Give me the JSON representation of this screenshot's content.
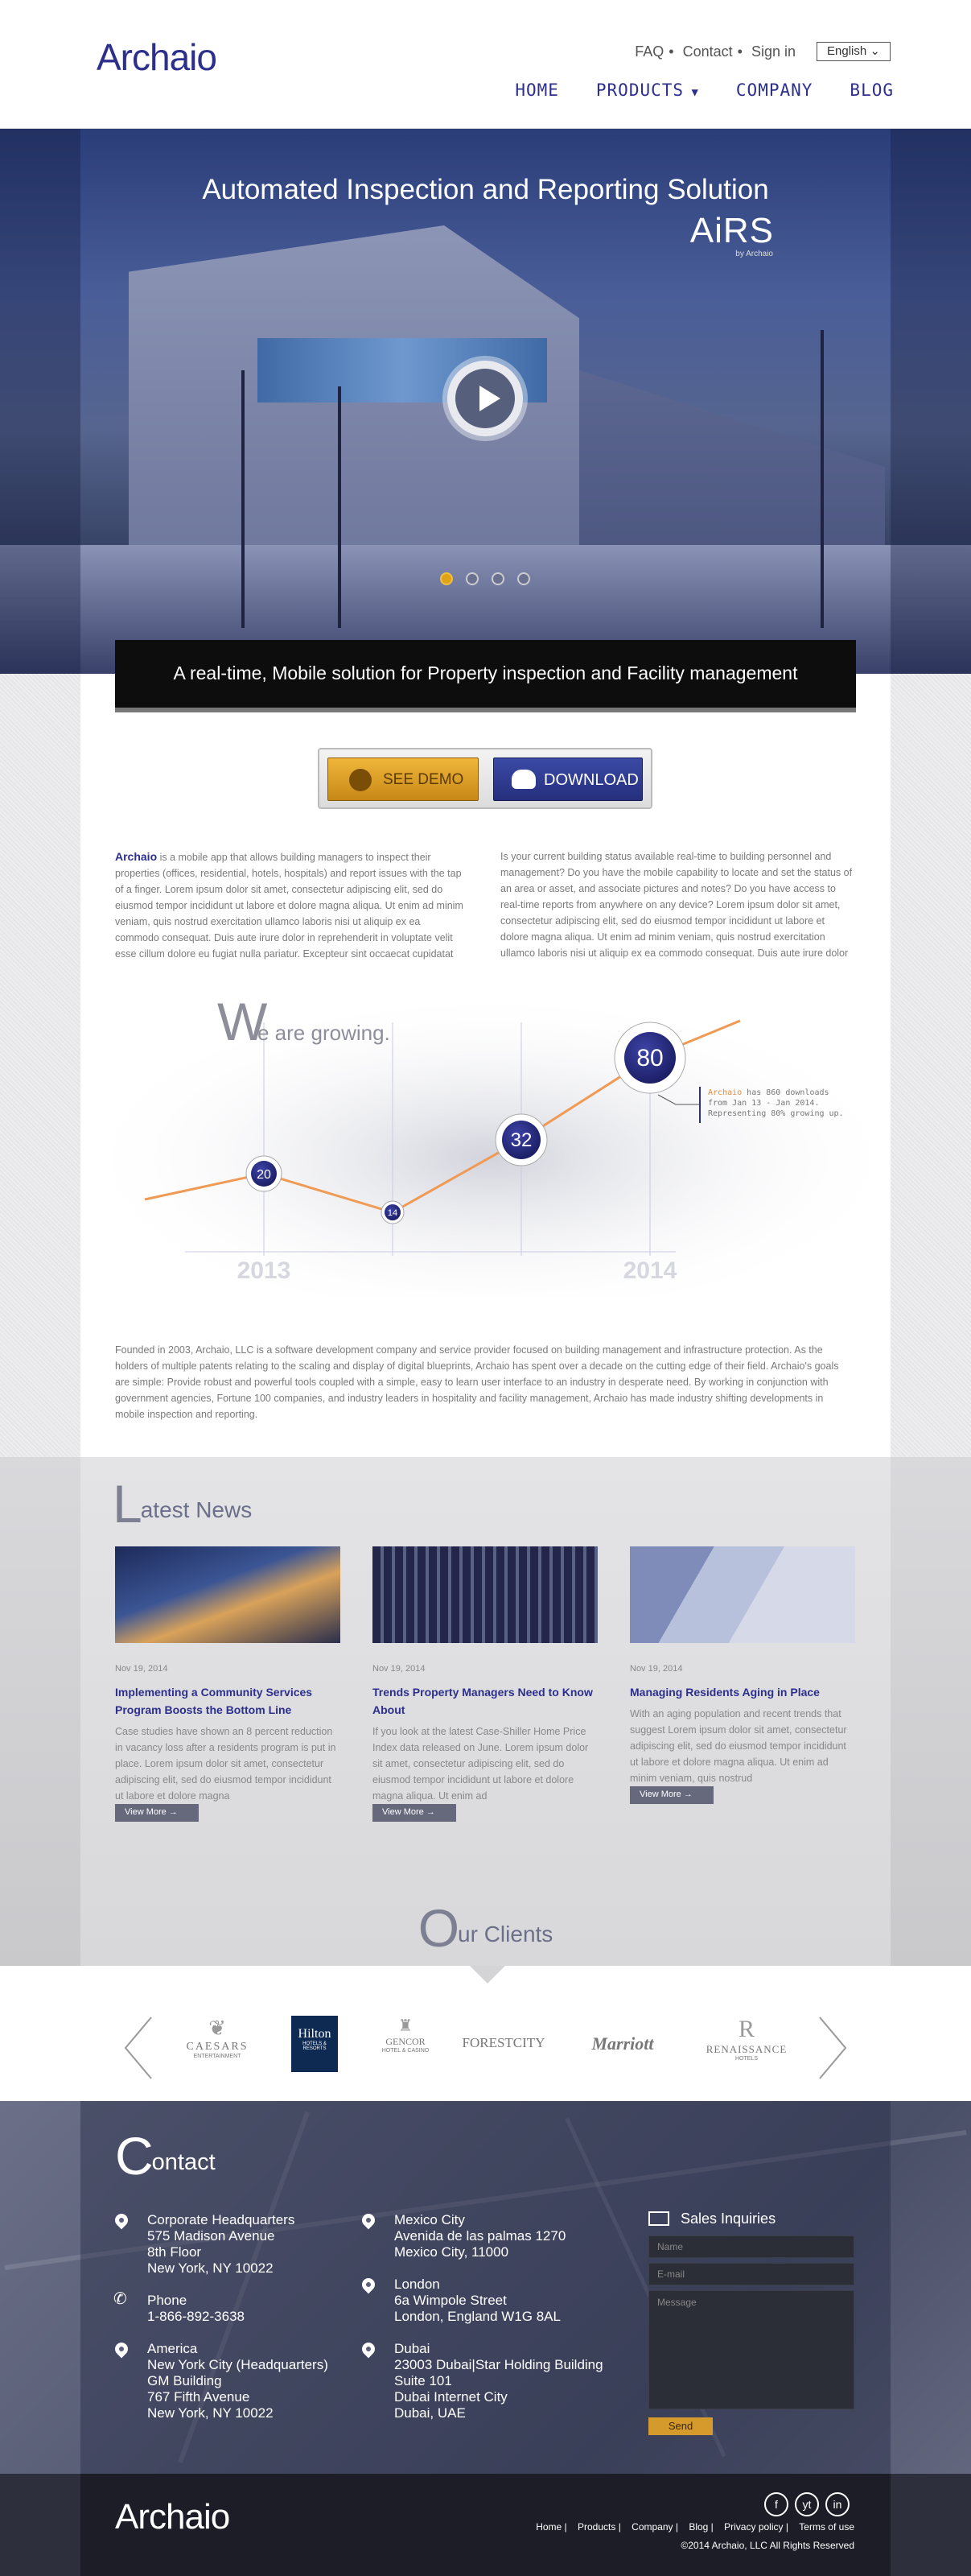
{
  "header": {
    "logo": "Archaio",
    "top_links": [
      "FAQ",
      "Contact",
      "Sign in"
    ],
    "language": "English",
    "nav": [
      "HOME",
      "PRODUCTS",
      "COMPANY",
      "BLOG"
    ]
  },
  "hero": {
    "title": "Automated Inspection and Reporting Solution",
    "product": "AiRS",
    "product_sub": "by Archaio",
    "slides": 4,
    "active_slide": 1,
    "tagline": "A real-time, Mobile solution for Property inspection and Facility management"
  },
  "buttons": {
    "demo": "SEE DEMO",
    "download": "DOWNLOAD"
  },
  "intro": {
    "left_brand": "Archaio",
    "left": " is a mobile app that allows building managers to inspect their properties (offices, residential, hotels, hospitals) and report issues with the tap of a finger. Lorem ipsum dolor sit amet, consectetur adipiscing elit, sed do eiusmod tempor incididunt ut labore et dolore magna aliqua. Ut enim ad minim veniam, quis nostrud exercitation ullamco laboris nisi ut aliquip ex ea commodo consequat. Duis aute irure dolor in reprehenderit in voluptate velit esse cillum dolore eu fugiat nulla pariatur. Excepteur sint occaecat cupidatat non proident, sunt in",
    "right": "Is your current building status available real-time to building personnel and management? Do you have the mobile capability to locate and set the status of an area or asset, and associate pictures and notes? Do you have access to real-time reports from anywhere on any device? Lorem ipsum dolor sit amet, consectetur adipiscing elit, sed do eiusmod tempor incididunt ut labore et dolore magna aliqua. Ut enim ad minim veniam, quis nostrud exercitation ullamco laboris nisi ut aliquip ex ea commodo consequat. Duis aute irure dolor in"
  },
  "growth": {
    "heading_initial": "W",
    "heading_rest": "e are growing.",
    "points": [
      "20",
      "14",
      "32",
      "80"
    ],
    "years": [
      "2013",
      "2014"
    ],
    "note_brand": "Archaio",
    "note_line1": " has 860 downloads",
    "note_line2": "from Jan 13 - Jan 2014.",
    "note_line3": "Representing 80% growing up."
  },
  "founded": "Founded in 2003, Archaio, LLC is a software development company and service provider focused on building management and infrastructure protection. As the holders of multiple patents relating to the scaling and display of digital blueprints, Archaio has spent over a decade on the cutting edge of their field. Archaio's goals are simple: Provide robust and powerful tools coupled with a simple, easy to learn user interface to an industry in desperate need. By working in conjunction with government agencies, Fortune 100 companies, and industry leaders in hospitality and facility management, Archaio has made industry shifting developments in mobile inspection and reporting.",
  "news": {
    "heading_initial": "L",
    "heading_rest": "atest News",
    "more_label": "View More",
    "items": [
      {
        "date": "Nov 19, 2014",
        "title": "Implementing a Community Services Program Boosts the Bottom Line",
        "text": "Case studies have shown an 8 percent reduction in vacancy loss after a residents program is put in place. Lorem ipsum dolor sit amet, consectetur adipiscing elit, sed do eiusmod tempor incididunt ut labore et dolore magna"
      },
      {
        "date": "Nov 19, 2014",
        "title": "Trends Property Managers Need to Know About",
        "text": "If you look at the latest Case-Shiller Home Price Index data released on June. Lorem ipsum dolor sit amet, consectetur adipiscing elit, sed do eiusmod tempor incididunt ut labore et dolore magna aliqua. Ut enim ad"
      },
      {
        "date": "Nov 19, 2014",
        "title": "Managing Residents Aging in Place",
        "text": "With an aging population and recent trends that suggest Lorem ipsum dolor sit amet, consectetur adipiscing elit, sed do eiusmod tempor incididunt ut labore et dolore magna aliqua. Ut enim ad minim veniam, quis nostrud"
      }
    ]
  },
  "clients": {
    "heading_initial": "O",
    "heading_rest": "ur Clients",
    "logos": [
      "CAESARS",
      "ENTERTAINMENT",
      "Hilton",
      "HOTELS & RESORTS",
      "GENCOR",
      "HOTEL & CASINO",
      "FORESTCITY",
      "Marriott",
      "R",
      "RENAISSANCE",
      "HOTELS"
    ]
  },
  "contact": {
    "heading_initial": "C",
    "heading_rest": "ontact",
    "locations": [
      {
        "lines": [
          "Corporate Headquarters",
          "575 Madison Avenue",
          "8th Floor",
          "New York, NY 10022"
        ]
      },
      {
        "lines": [
          "Phone",
          "1-866-892-3638"
        ]
      },
      {
        "lines": [
          "America",
          "New York City (Headquarters)",
          "GM Building",
          "767 Fifth Avenue",
          "New York, NY 10022"
        ]
      },
      {
        "lines": [
          "Mexico City",
          "Avenida de las palmas 1270",
          "Mexico City, 11000"
        ]
      },
      {
        "lines": [
          "London",
          "6a Wimpole Street",
          "London, England W1G 8AL"
        ]
      },
      {
        "lines": [
          "Dubai",
          "23003 Dubai|Star Holding Building",
          "Suite 101",
          "Dubai Internet City",
          "Dubai, UAE"
        ]
      }
    ],
    "form": {
      "title": "Sales Inquiries",
      "name_placeholder": "Name",
      "email_placeholder": "E-mail",
      "message_placeholder": "Message",
      "send": "Send"
    }
  },
  "footer": {
    "logo": "Archaio",
    "social": [
      "f",
      "yt",
      "in"
    ],
    "links": [
      "Home",
      "Products",
      "Company",
      "Blog",
      "Privacy policy",
      "Terms of use"
    ],
    "copyright": "©2014 Archaio, LLC All Rights Reserved"
  },
  "colors": {
    "brand": "#2c2f8c",
    "accent": "#e0a217",
    "hero": "#2a3d78"
  }
}
